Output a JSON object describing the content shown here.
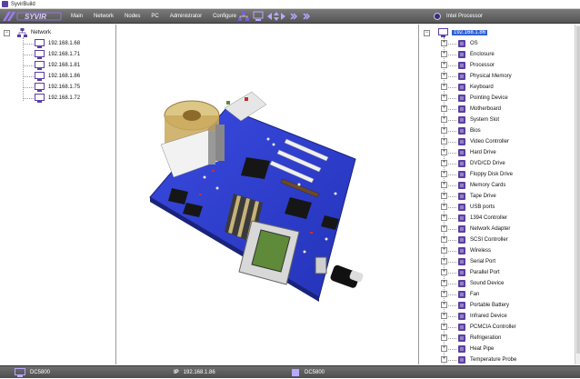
{
  "window": {
    "title": "SyvirBuild"
  },
  "menu": [
    "Main",
    "Network",
    "Nodes",
    "PC",
    "Administrator",
    "Configure"
  ],
  "logo_text": "SYVIR",
  "toolbar_status": {
    "processor": "Intel Processor"
  },
  "left_tree": {
    "root": "Network",
    "hosts": [
      "192.168.1.68",
      "192.168.1.71",
      "192.168.1.81",
      "192.168.1.86",
      "192.168.1.75",
      "192.168.1.72"
    ]
  },
  "right_tree": {
    "root": "192.168.1.86",
    "items": [
      {
        "label": "OS",
        "icon": "windows-icon"
      },
      {
        "label": "Enclosure",
        "icon": "enclosure-icon"
      },
      {
        "label": "Processor",
        "icon": "processor-icon"
      },
      {
        "label": "Physical Memory",
        "icon": "memory-icon"
      },
      {
        "label": "Keyboard",
        "icon": "keyboard-icon"
      },
      {
        "label": "Pointing Device",
        "icon": "mouse-icon"
      },
      {
        "label": "Motherboard",
        "icon": "motherboard-icon"
      },
      {
        "label": "System Slot",
        "icon": "slot-icon"
      },
      {
        "label": "Bios",
        "icon": "bios-icon"
      },
      {
        "label": "Video Controller",
        "icon": "video-icon"
      },
      {
        "label": "Hard Drive",
        "icon": "hard-drive-icon"
      },
      {
        "label": "DVD/CD Drive",
        "icon": "dvd-icon"
      },
      {
        "label": "Floppy Disk Drive",
        "icon": "floppy-icon"
      },
      {
        "label": "Memory Cards",
        "icon": "memory-card-icon"
      },
      {
        "label": "Tape Drive",
        "icon": "tape-icon"
      },
      {
        "label": "USB ports",
        "icon": "usb-icon"
      },
      {
        "label": "1394 Controller",
        "icon": "firewire-icon"
      },
      {
        "label": "Network Adapter",
        "icon": "network-adapter-icon"
      },
      {
        "label": "SCSI Controller",
        "icon": "scsi-icon"
      },
      {
        "label": "Wireless",
        "icon": "wireless-icon"
      },
      {
        "label": "Serial Port",
        "icon": "serial-port-icon"
      },
      {
        "label": "Parallel Port",
        "icon": "parallel-port-icon"
      },
      {
        "label": "Sound Device",
        "icon": "sound-icon"
      },
      {
        "label": "Fan",
        "icon": "fan-icon"
      },
      {
        "label": "Portable Battery",
        "icon": "battery-icon"
      },
      {
        "label": "Infrared Device",
        "icon": "infrared-icon"
      },
      {
        "label": "PCMCIA Controller",
        "icon": "pcmcia-icon"
      },
      {
        "label": "Refrigeration",
        "icon": "refrigeration-icon"
      },
      {
        "label": "Heat Pipe",
        "icon": "heat-pipe-icon"
      },
      {
        "label": "Temperature Probe",
        "icon": "temperature-icon"
      }
    ]
  },
  "statusbar": {
    "left": "DC5800",
    "ip_tag": "IP",
    "ip": "192.168.1.86",
    "right": "DC5800"
  },
  "colors": {
    "accent": "#5b3fa3",
    "selection": "#3062d6",
    "board": "#2f3fd0"
  }
}
